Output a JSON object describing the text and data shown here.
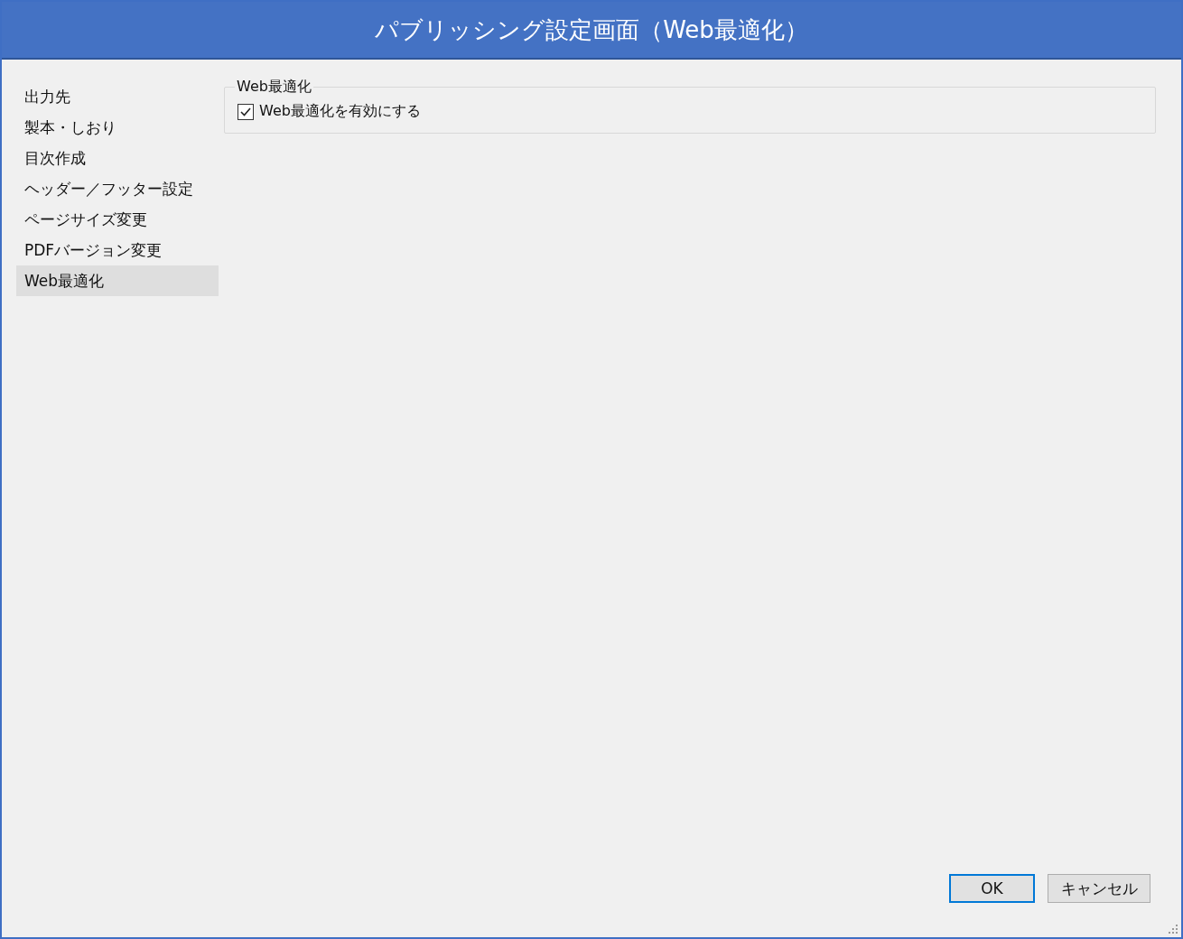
{
  "window": {
    "title": "パブリッシング設定画面（Web最適化）"
  },
  "sidebar": {
    "items": [
      {
        "label": "出力先",
        "selected": false
      },
      {
        "label": "製本・しおり",
        "selected": false
      },
      {
        "label": "目次作成",
        "selected": false
      },
      {
        "label": "ヘッダー／フッター設定",
        "selected": false
      },
      {
        "label": "ページサイズ変更",
        "selected": false
      },
      {
        "label": "PDFバージョン変更",
        "selected": false
      },
      {
        "label": "Web最適化",
        "selected": true
      }
    ]
  },
  "group": {
    "title": "Web最適化",
    "checkbox": {
      "label": "Web最適化を有効にする",
      "checked": true
    }
  },
  "buttons": [
    {
      "label": "OK",
      "default": true
    },
    {
      "label": "キャンセル",
      "default": false
    }
  ]
}
